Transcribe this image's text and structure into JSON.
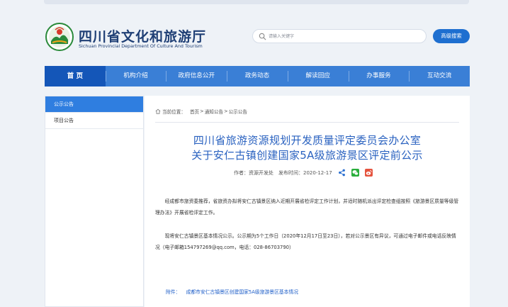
{
  "header": {
    "site_title": "四川省文化和旅游厅",
    "site_subtitle": "Sichuan Provincial Department Of Culture And Tourism",
    "search_placeholder": "请输入关键字",
    "advanced_search": "高级搜索",
    "brand_color": "#1f3f75"
  },
  "nav": {
    "items": [
      {
        "label": "首 页",
        "active": true
      },
      {
        "label": "机构介绍"
      },
      {
        "label": "政府信息公开"
      },
      {
        "label": "政务动态"
      },
      {
        "label": "解读回应"
      },
      {
        "label": "办事服务"
      },
      {
        "label": "互动交流"
      }
    ],
    "color": "#3a7fd6"
  },
  "sidebar": {
    "items": [
      {
        "label": "公示公告",
        "active": true
      },
      {
        "label": "项目公告"
      }
    ]
  },
  "breadcrumb": {
    "prefix": "当前位置：",
    "items": [
      "首页",
      "通知公告",
      "公示公告"
    ],
    "separator": ">"
  },
  "article": {
    "title_line1": "四川省旅游资源规划开发质量评定委员会办公室",
    "title_line2": "关于安仁古镇创建国家5A级旅游景区评定前公示",
    "author": "作者：资源开发处",
    "publish_time": "发布时间：2020-12-17",
    "share_icons": [
      "share-icon",
      "wechat-icon",
      "weibo-icon"
    ],
    "para1": "经成都市旅资委推荐，省旅资办拟将安仁古镇景区纳入近期开展省检评定工作计划，并适时随机派出评定检查组按照《旅游景区质量等级管理办法》开展省检评定工作。",
    "para2": "现将安仁古镇景区基本情况公示。公示期为5个工作日（2020年12月17日至23日），若对公示景区有异议，可通过电子邮件或电话反映情况（电子邮箱154797269@qq.com，电话：028-86703790）",
    "attachment_label": "附件：",
    "attachment_link": "成都市安仁古镇景区创建国家5A级旅游景区基本情况"
  }
}
